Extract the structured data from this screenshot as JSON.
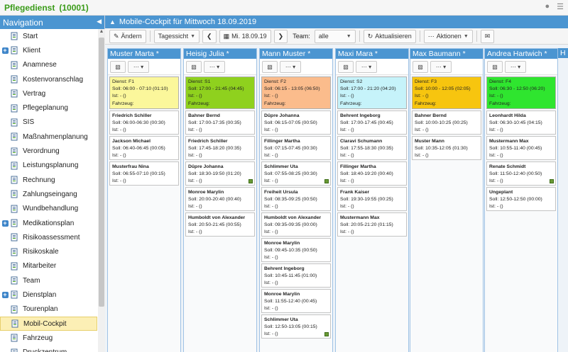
{
  "app": {
    "title": "Pflegedienst",
    "id": "(10001)"
  },
  "topbar_icons": [
    "user-icon",
    "menu-icon"
  ],
  "nav": {
    "header": "Navigation",
    "items": [
      {
        "label": "Start",
        "icon": "home-icon",
        "expand": false,
        "active": false
      },
      {
        "label": "Klient",
        "icon": "user-icon",
        "expand": true,
        "active": false
      },
      {
        "label": "Anamnese",
        "icon": "document-icon",
        "expand": false,
        "active": false
      },
      {
        "label": "Kostenvoranschlag",
        "icon": "calculator-icon",
        "expand": false,
        "active": false
      },
      {
        "label": "Vertrag",
        "icon": "contract-icon",
        "expand": false,
        "active": false
      },
      {
        "label": "Pflegeplanung",
        "icon": "document-icon",
        "expand": false,
        "active": false
      },
      {
        "label": "SIS",
        "icon": "document-icon",
        "expand": false,
        "active": false
      },
      {
        "label": "Maßnahmenplanung",
        "icon": "checklist-icon",
        "expand": false,
        "active": false
      },
      {
        "label": "Verordnung",
        "icon": "prescription-icon",
        "expand": false,
        "active": false
      },
      {
        "label": "Leistungsplanung",
        "icon": "document-icon",
        "expand": false,
        "active": false
      },
      {
        "label": "Rechnung",
        "icon": "invoice-icon",
        "expand": false,
        "active": false
      },
      {
        "label": "Zahlungseingang",
        "icon": "payment-icon",
        "expand": false,
        "active": false
      },
      {
        "label": "Wundbehandlung",
        "icon": "bandage-icon",
        "expand": false,
        "active": false
      },
      {
        "label": "Medikationsplan",
        "icon": "medication-icon",
        "expand": true,
        "active": false
      },
      {
        "label": "Risikoassessment",
        "icon": "magnifier-icon",
        "expand": false,
        "active": false
      },
      {
        "label": "Risikoskale",
        "icon": "magnifier-icon",
        "expand": false,
        "active": false
      },
      {
        "label": "Mitarbeiter",
        "icon": "staff-icon",
        "expand": false,
        "active": false
      },
      {
        "label": "Team",
        "icon": "team-icon",
        "expand": false,
        "active": false
      },
      {
        "label": "Dienstplan",
        "icon": "calendar-icon",
        "expand": true,
        "active": false
      },
      {
        "label": "Tourenplan",
        "icon": "tour-icon",
        "expand": false,
        "active": false
      },
      {
        "label": "Mobil-Cockpit",
        "icon": "car-icon",
        "expand": false,
        "active": true
      },
      {
        "label": "Fahrzeug",
        "icon": "vehicle-icon",
        "expand": false,
        "active": false
      },
      {
        "label": "Druckzentrum",
        "icon": "printer-icon",
        "expand": false,
        "active": false
      }
    ]
  },
  "main": {
    "title": "Mobile-Cockpit für Mittwoch 18.09.2019",
    "toolbar": {
      "edit_label": "Ändern",
      "view_label": "Tagessicht",
      "date_label": "Mi. 18.09.19",
      "team_label": "Team:",
      "team_value": "alle",
      "refresh_label": "Aktualisieren",
      "actions_label": "Aktionen"
    }
  },
  "colors": {
    "accent": "#4b95d1",
    "brand_green": "#3a9b18",
    "duty_f1": "#fbf79b",
    "duty_s1": "#8fd11e",
    "duty_f2": "#fbbc8c",
    "duty_s2": "#c6f3fa",
    "duty_f3": "#f7c50f",
    "duty_f4": "#2fe52f"
  },
  "columns": [
    {
      "name": "Muster Marta *",
      "duty": {
        "dienst": "Dienst: F1",
        "soll": "Soll: 06:00 - 07:10  (01:10)",
        "ist": "Ist:  -  ()",
        "fahrzeug": "Fahrzeug:",
        "color": "#fbf79b"
      },
      "cards": [
        {
          "name": "Friedrich Schiller",
          "soll": "Soll: 06:00-06:30  (00:30)",
          "ist": "Ist:  -  ()",
          "flag": false
        },
        {
          "name": "Jackson Michael",
          "soll": "Soll: 06:40-06:45  (00:05)",
          "ist": "Ist:  -  ()",
          "flag": false
        },
        {
          "name": "Musterfrau Nina",
          "soll": "Soll: 06:55-07:10  (00:15)",
          "ist": "Ist:  -  ()",
          "flag": false
        }
      ]
    },
    {
      "name": "Heisig Julia *",
      "duty": {
        "dienst": "Dienst: S1",
        "soll": "Soll: 17:00 - 21:45  (04:45)",
        "ist": "Ist:  -  ()",
        "fahrzeug": "Fahrzeug:",
        "color": "#8fd11e"
      },
      "cards": [
        {
          "name": "Bahner Bernd",
          "soll": "Soll: 17:00-17:35  (00:35)",
          "ist": "Ist:  -  ()",
          "flag": false
        },
        {
          "name": "Friedrich Schiller",
          "soll": "Soll: 17:45-18:20  (00:35)",
          "ist": "Ist:  -  ()",
          "flag": false
        },
        {
          "name": "Düpre Johanna",
          "soll": "Soll: 18:30-19:50  (01:20)",
          "ist": "Ist:  -  ()",
          "flag": true
        },
        {
          "name": "Monroe Marylin",
          "soll": "Soll: 20:00-20:40  (00:40)",
          "ist": "Ist:  -  ()",
          "flag": false
        },
        {
          "name": "Humboldt von Alexander",
          "soll": "Soll: 20:50-21:45  (00:55)",
          "ist": "Ist:  -  ()",
          "flag": false
        }
      ]
    },
    {
      "name": "Mann Muster *",
      "duty": {
        "dienst": "Dienst: F2",
        "soll": "Soll: 06:15 - 13:05  (06:50)",
        "ist": "Ist:  -  ()",
        "fahrzeug": "Fahrzeug:",
        "color": "#fbbc8c"
      },
      "cards": [
        {
          "name": "Düpre Johanna",
          "soll": "Soll: 06:15-07:05  (00:50)",
          "ist": "Ist:  -  ()",
          "flag": false
        },
        {
          "name": "Fillinger Martha",
          "soll": "Soll: 07:15-07:45  (00:30)",
          "ist": "Ist:  -  ()",
          "flag": false
        },
        {
          "name": "Schlimmer Uta",
          "soll": "Soll: 07:55-08:25  (00:30)",
          "ist": "Ist:  -  ()",
          "flag": true
        },
        {
          "name": "Freiheit Ursula",
          "soll": "Soll: 08:35-09:25  (00:50)",
          "ist": "Ist:  -  ()",
          "flag": false
        },
        {
          "name": "Humboldt von Alexander",
          "soll": "Soll: 09:35-09:35  (00:00)",
          "ist": "Ist:  -  ()",
          "flag": false
        },
        {
          "name": "Monroe Marylin",
          "soll": "Soll: 09:45-10:35  (00:50)",
          "ist": "Ist:  -  ()",
          "flag": false
        },
        {
          "name": "Behrent Ingeborg",
          "soll": "Soll: 10:45-11:45  (01:00)",
          "ist": "Ist:  -  ()",
          "flag": false
        },
        {
          "name": "Monroe Marylin",
          "soll": "Soll: 11:55-12:40  (00:45)",
          "ist": "Ist:  -  ()",
          "flag": false
        },
        {
          "name": "Schlimmer Uta",
          "soll": "Soll: 12:50-13:05  (00:15)",
          "ist": "Ist:  -  ()",
          "flag": true
        }
      ]
    },
    {
      "name": "Maxi Mara *",
      "duty": {
        "dienst": "Dienst: S2",
        "soll": "Soll: 17:00 - 21:20  (04:20)",
        "ist": "Ist:  -  ()",
        "fahrzeug": "Fahrzeug:",
        "color": "#c6f3fa"
      },
      "cards": [
        {
          "name": "Behrent Ingeborg",
          "soll": "Soll: 17:00-17:45  (00:45)",
          "ist": "Ist:  -  ()",
          "flag": false
        },
        {
          "name": "Claravi Schumann",
          "soll": "Soll: 17:55-18:30  (00:35)",
          "ist": "Ist:  -  ()",
          "flag": false
        },
        {
          "name": "Fillinger Martha",
          "soll": "Soll: 18:40-19:20  (00:40)",
          "ist": "Ist:  -  ()",
          "flag": false
        },
        {
          "name": "Frank Kaiser",
          "soll": "Soll: 19:30-19:55  (00:25)",
          "ist": "Ist:  -  ()",
          "flag": false
        },
        {
          "name": "Mustermann Max",
          "soll": "Soll: 20:05-21:20  (01:15)",
          "ist": "Ist:  -  ()",
          "flag": false
        }
      ]
    },
    {
      "name": "Max Baumann *",
      "duty": {
        "dienst": "Dienst: F3",
        "soll": "Soll: 10:00 - 12:05  (02:05)",
        "ist": "Ist:  -  ()",
        "fahrzeug": "Fahrzeug:",
        "color": "#f7c50f"
      },
      "cards": [
        {
          "name": "Bahner Bernd",
          "soll": "Soll: 10:00-10:25  (00:25)",
          "ist": "Ist:  -  ()",
          "flag": false
        },
        {
          "name": "Muster Mann",
          "soll": "Soll: 10:35-12:05  (01:30)",
          "ist": "Ist:  -  ()",
          "flag": false
        }
      ]
    },
    {
      "name": "Andrea Hartwich *",
      "duty": {
        "dienst": "Dienst: F4",
        "soll": "Soll: 06:30 - 12:50  (06:20)",
        "ist": "Ist:  -  ()",
        "fahrzeug": "Fahrzeug:",
        "color": "#2fe52f"
      },
      "cards": [
        {
          "name": "Leonhardt Hilda",
          "soll": "Soll: 06:30-10:45  (04:15)",
          "ist": "Ist:  -  ()",
          "flag": false
        },
        {
          "name": "Mustermann Max",
          "soll": "Soll: 10:55-11:40  (00:45)",
          "ist": "Ist:  -  ()",
          "flag": false
        },
        {
          "name": "Renate Schmidt",
          "soll": "Soll: 11:50-12:40  (00:50)",
          "ist": "Ist:  -  ()",
          "flag": true
        },
        {
          "name": "Ungeplant",
          "soll": "Soll: 12:50-12:50  (00:00)",
          "ist": "Ist:  -  ()",
          "flag": false
        }
      ]
    }
  ],
  "next_column_stub": "H"
}
